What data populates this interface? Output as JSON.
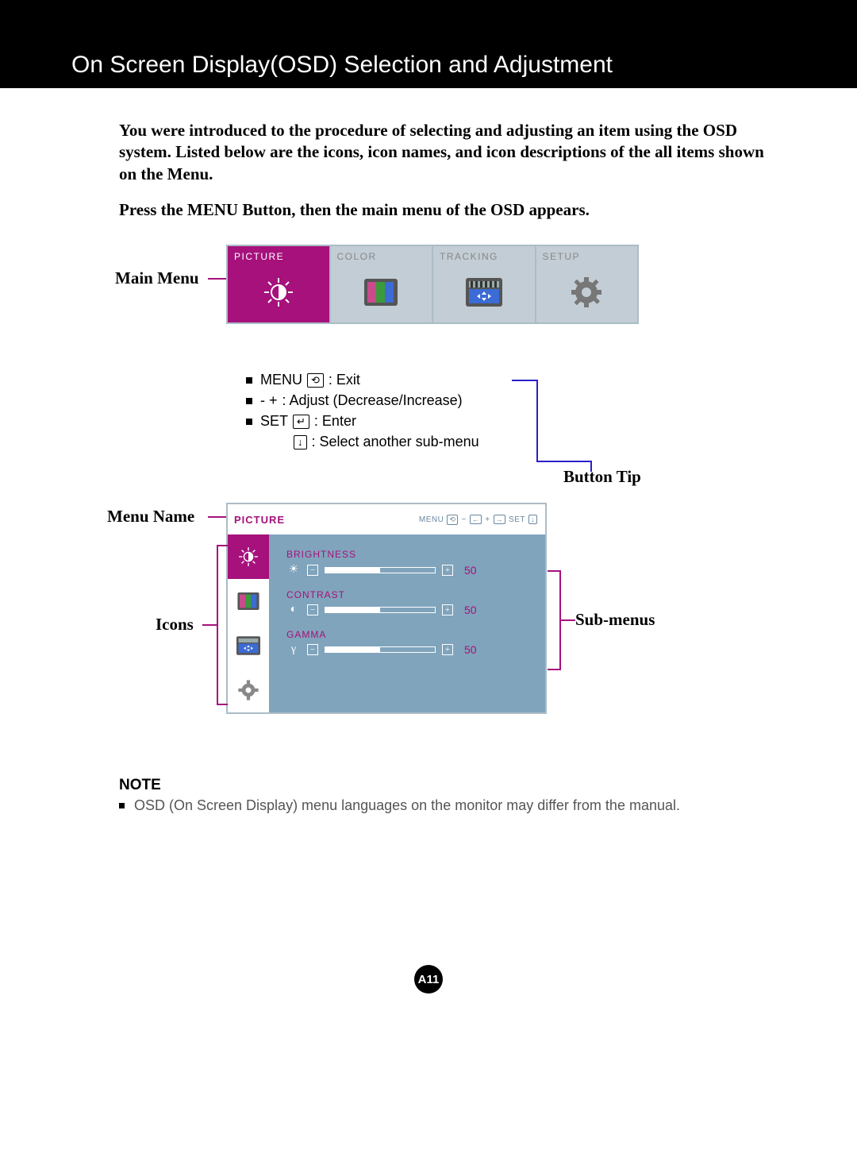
{
  "title": "On Screen Display(OSD) Selection and Adjustment",
  "intro": {
    "p1": "You were introduced to the procedure of selecting and adjusting an item using the OSD system.  Listed below are the icons, icon names, and icon descriptions of the all items shown on the Menu.",
    "p2": "Press the MENU Button, then the main menu of the OSD appears."
  },
  "tabs": {
    "picture": "PICTURE",
    "color": "COLOR",
    "tracking": "TRACKING",
    "setup": "SETUP"
  },
  "callouts": {
    "main_menu": "Main Menu",
    "menu_name": "Menu Name",
    "icons": "Icons",
    "button_tip": "Button Tip",
    "sub_menus": "Sub-menus"
  },
  "legend": {
    "menu": "MENU",
    "menu_action": ": Exit",
    "adjust_keys": "- +",
    "adjust_action": ": Adjust (Decrease/Increase)",
    "set": "SET",
    "set_action": ": Enter",
    "select": ": Select another sub-menu"
  },
  "osd": {
    "menu_name": "PICTURE",
    "hdr_menu": "MENU",
    "hdr_set": "SET",
    "subs": {
      "brightness": {
        "label": "BRIGHTNESS",
        "value": "50"
      },
      "contrast": {
        "label": "CONTRAST",
        "value": "50"
      },
      "gamma": {
        "label": "GAMMA",
        "value": "50"
      }
    }
  },
  "note": {
    "heading": "NOTE",
    "body": "OSD (On Screen Display) menu languages on the monitor may differ from the manual."
  },
  "page_number": "A11"
}
